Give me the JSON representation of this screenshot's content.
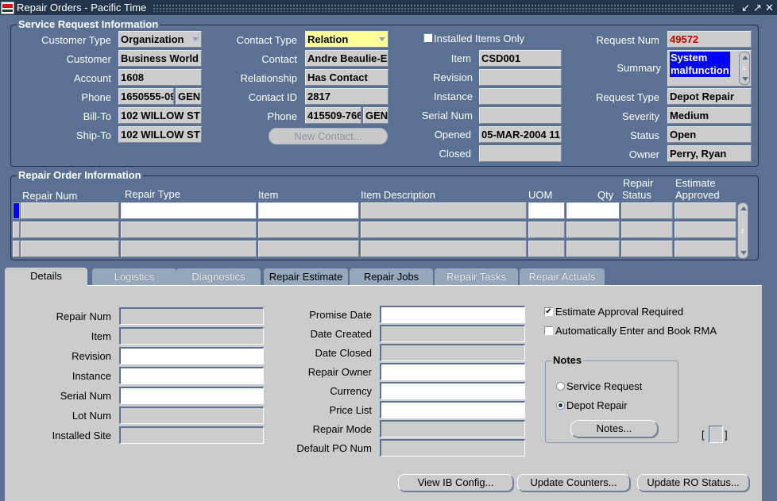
{
  "window": {
    "title": "Repair Orders - Pacific Time",
    "controls": {
      "minimize": "minimize-icon",
      "maximize": "maximize-icon",
      "close": "close-icon"
    }
  },
  "service_request": {
    "section_title": "Service Request Information",
    "customer_type": {
      "label": "Customer Type",
      "value": "Organization"
    },
    "customer": {
      "label": "Customer",
      "value": "Business World"
    },
    "account": {
      "label": "Account",
      "value": "1608"
    },
    "phone": {
      "label": "Phone",
      "value": "1650555-09",
      "type": "GEN"
    },
    "bill_to": {
      "label": "Bill-To",
      "value": "102 WILLOW ST"
    },
    "ship_to": {
      "label": "Ship-To",
      "value": "102 WILLOW ST"
    },
    "contact_type": {
      "label": "Contact Type",
      "value": "Relation"
    },
    "contact": {
      "label": "Contact",
      "value": "Andre Beaulie-E"
    },
    "relationship": {
      "label": "Relationship",
      "value": "Has Contact"
    },
    "contact_id": {
      "label": "Contact ID",
      "value": "2817"
    },
    "contact_phone": {
      "label": "Phone",
      "value": "415509-766",
      "type": "GEN"
    },
    "new_contact_button": "New Contact...",
    "installed_items_only": {
      "label": "Installed Items Only",
      "checked": false
    },
    "item": {
      "label": "Item",
      "value": "CSD001"
    },
    "revision": {
      "label": "Revision",
      "value": ""
    },
    "instance": {
      "label": "Instance",
      "value": ""
    },
    "serial_num": {
      "label": "Serial Num",
      "value": ""
    },
    "opened": {
      "label": "Opened",
      "value": "05-MAR-2004 11:"
    },
    "closed": {
      "label": "Closed",
      "value": ""
    },
    "request_num": {
      "label": "Request Num",
      "value": "49572"
    },
    "summary": {
      "label": "Summary",
      "value_line1": "System",
      "value_line2": "malfunction"
    },
    "request_type": {
      "label": "Request Type",
      "value": "Depot Repair"
    },
    "severity": {
      "label": "Severity",
      "value": "Medium"
    },
    "status": {
      "label": "Status",
      "value": "Open"
    },
    "owner": {
      "label": "Owner",
      "value": "Perry, Ryan"
    }
  },
  "repair_order": {
    "section_title": "Repair Order Information",
    "columns": {
      "repair_num": "Repair Num",
      "repair_type": "Repair Type",
      "item": "Item",
      "item_description": "Item Description",
      "uom": "UOM",
      "qty": "Qty",
      "repair_status_1": "Repair",
      "repair_status_2": "Status",
      "estimate_approved_1": "Estimate",
      "estimate_approved_2": "Approved"
    },
    "rows": [
      {
        "repair_num": "",
        "repair_type": "",
        "item": "",
        "item_description": "",
        "uom": "",
        "qty": "",
        "repair_status": "",
        "estimate_approved": ""
      },
      {
        "repair_num": "",
        "repair_type": "",
        "item": "",
        "item_description": "",
        "uom": "",
        "qty": "",
        "repair_status": "",
        "estimate_approved": ""
      },
      {
        "repair_num": "",
        "repair_type": "",
        "item": "",
        "item_description": "",
        "uom": "",
        "qty": "",
        "repair_status": "",
        "estimate_approved": ""
      }
    ]
  },
  "tabs": [
    {
      "label": "Details",
      "state": "active"
    },
    {
      "label": "Logistics",
      "state": "disabled"
    },
    {
      "label": "Diagnostics",
      "state": "disabled"
    },
    {
      "label": "Repair Estimate",
      "state": "enabled"
    },
    {
      "label": "Repair Jobs",
      "state": "enabled"
    },
    {
      "label": "Repair Tasks",
      "state": "disabled"
    },
    {
      "label": "Repair Actuals",
      "state": "disabled"
    }
  ],
  "details": {
    "left": [
      {
        "label": "Repair Num",
        "value": ""
      },
      {
        "label": "Item",
        "value": ""
      },
      {
        "label": "Revision",
        "value": ""
      },
      {
        "label": "Instance",
        "value": ""
      },
      {
        "label": "Serial Num",
        "value": ""
      },
      {
        "label": "Lot Num",
        "value": ""
      },
      {
        "label": "Installed Site",
        "value": ""
      }
    ],
    "middle": [
      {
        "label": "Promise Date",
        "value": ""
      },
      {
        "label": "Date Created",
        "value": ""
      },
      {
        "label": "Date Closed",
        "value": ""
      },
      {
        "label": "Repair Owner",
        "value": ""
      },
      {
        "label": "Currency",
        "value": ""
      },
      {
        "label": "Price List",
        "value": ""
      },
      {
        "label": "Repair Mode",
        "value": ""
      },
      {
        "label": "Default PO Num",
        "value": ""
      }
    ],
    "estimate_approval_required": {
      "label": "Estimate Approval Required",
      "checked": true
    },
    "auto_enter_book_rma": {
      "label": "Automatically Enter and Book RMA",
      "checked": false
    },
    "notes": {
      "title": "Notes",
      "options": [
        {
          "label": "Service Request",
          "selected": false
        },
        {
          "label": "Depot Repair",
          "selected": true
        }
      ],
      "button": "Notes..."
    },
    "bracket_left": "[",
    "bracket_right": "]"
  },
  "footer_buttons": {
    "view_ib_config": "View IB Config...",
    "update_counters": "Update Counters...",
    "update_ro_status": "Update RO Status..."
  },
  "colors": {
    "background": "#5a7194",
    "titlebar": "#22354a",
    "field": "#cccccc",
    "highlight": "#0000ff",
    "request_num": "#cc0000",
    "required_field": "#ffff99"
  }
}
